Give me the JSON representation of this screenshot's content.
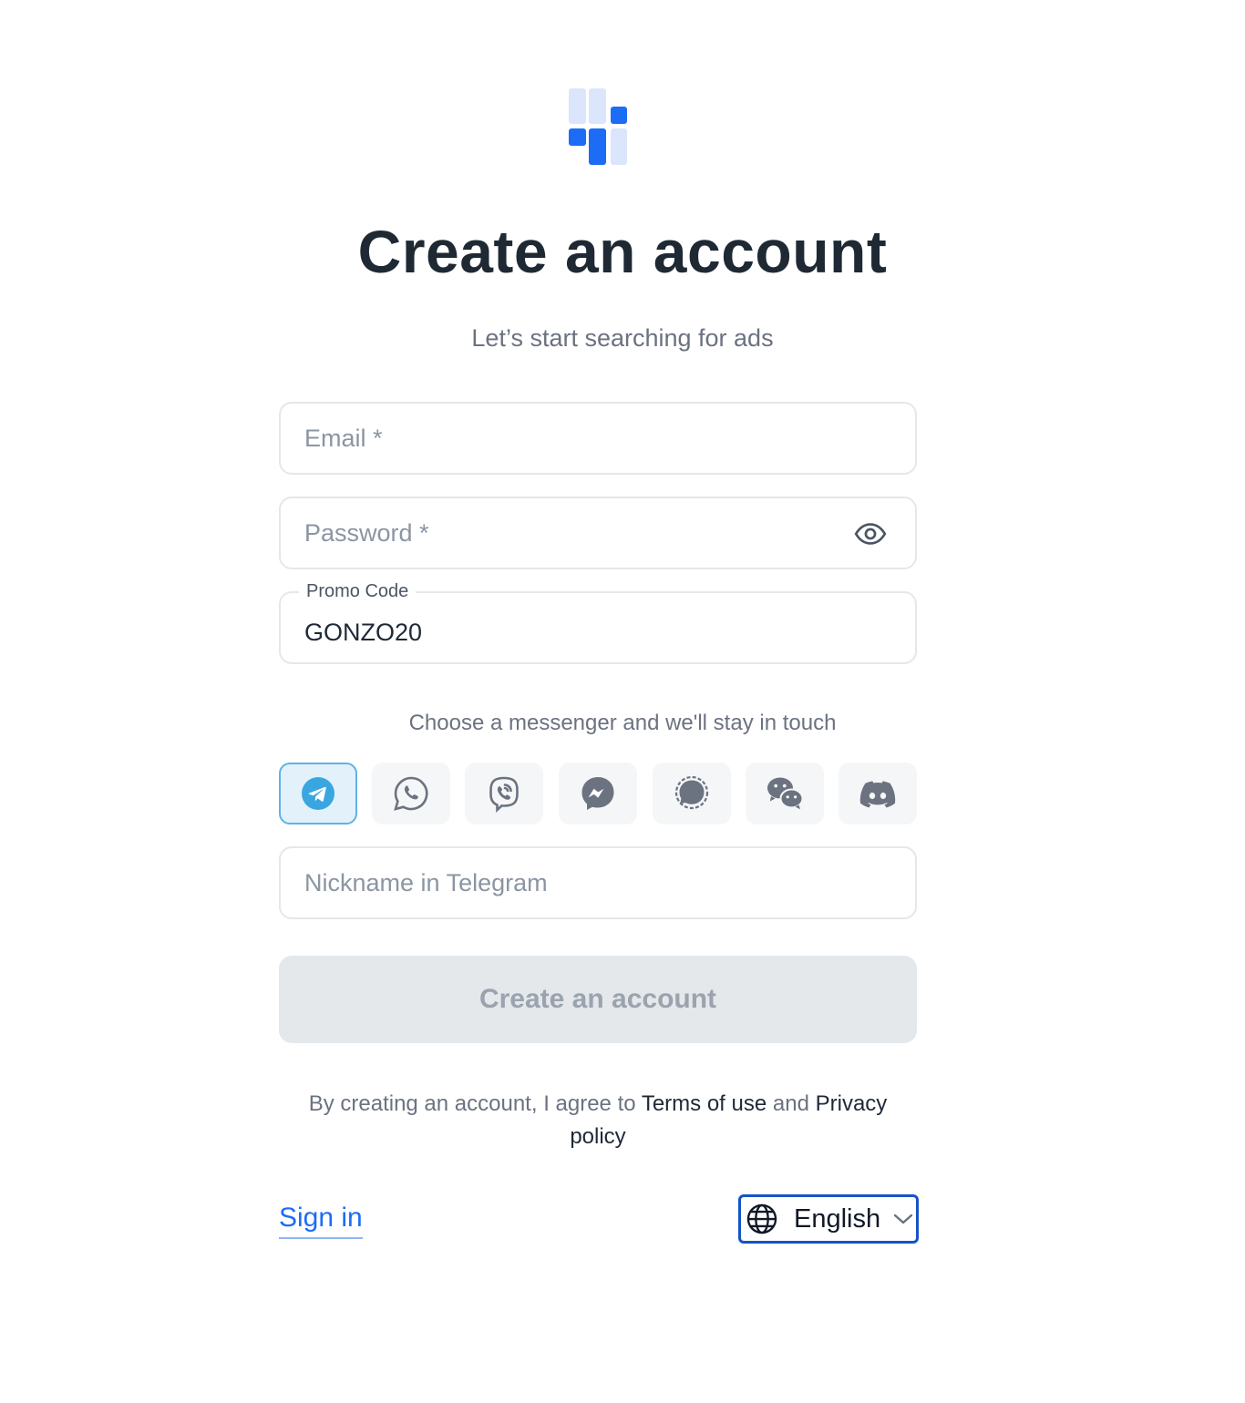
{
  "page": {
    "title": "Create an account",
    "subtitle": "Let’s start searching for ads"
  },
  "colors": {
    "brand": "#1d6cf5",
    "logo_light": "#dbe6fd",
    "telegram": "#3aa6e0",
    "cta_disabled_bg": "#e5e8eb"
  },
  "form": {
    "email": {
      "placeholder": "Email *",
      "value": ""
    },
    "password": {
      "placeholder": "Password *",
      "value": "",
      "toggle_icon": "eye-icon"
    },
    "promo": {
      "label": "Promo Code",
      "value": "GONZO20"
    },
    "messenger_prompt": "Choose a messenger and we'll stay in touch",
    "messengers": [
      {
        "name": "Telegram",
        "icon": "telegram-icon",
        "selected": true
      },
      {
        "name": "WhatsApp",
        "icon": "whatsapp-icon",
        "selected": false
      },
      {
        "name": "Viber",
        "icon": "viber-icon",
        "selected": false
      },
      {
        "name": "Messenger",
        "icon": "messenger-icon",
        "selected": false
      },
      {
        "name": "Signal",
        "icon": "signal-icon",
        "selected": false
      },
      {
        "name": "WeChat",
        "icon": "wechat-icon",
        "selected": false
      },
      {
        "name": "Discord",
        "icon": "discord-icon",
        "selected": false
      }
    ],
    "nickname": {
      "placeholder": "Nickname in Telegram",
      "value": ""
    },
    "submit_label": "Create an account"
  },
  "legal": {
    "prefix": "By creating an account, I agree to ",
    "terms_label": "Terms of use",
    "joiner": " and ",
    "privacy_label": "Privacy policy"
  },
  "footer": {
    "signin_label": "Sign in",
    "language": {
      "selected": "English",
      "icon": "globe-icon"
    }
  }
}
